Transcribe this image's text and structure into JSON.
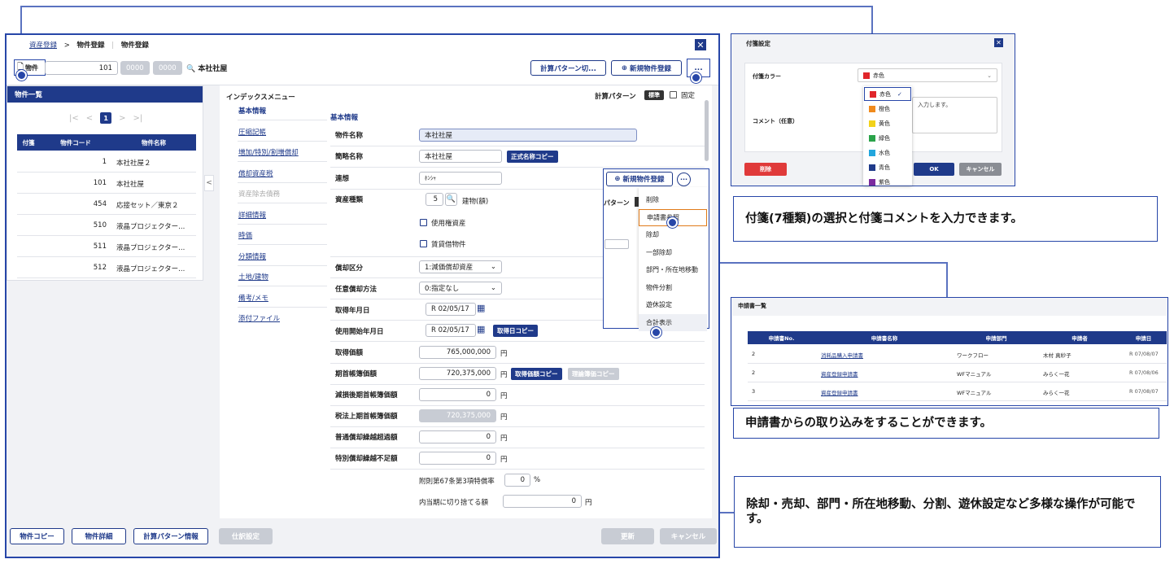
{
  "window": {
    "breadcrumb": {
      "root": "資産登録",
      "sep": ">",
      "parent": "物件登録",
      "current": "物件登録"
    },
    "toolbar": {
      "tag_label": "物件",
      "code_value": "101",
      "sub_code_1": "0000",
      "sub_code_2": "0000",
      "asset_name": "本社社屋",
      "calc_pattern_btn": "計算パターン切...",
      "new_asset_btn": "新規物件登録",
      "more_btn": "..."
    },
    "list_panel": {
      "title": "物件一覧",
      "page": "1",
      "columns": [
        "付箋",
        "物件コード",
        "物件名称"
      ],
      "rows": [
        {
          "code": "1",
          "name": "本社社屋２"
        },
        {
          "code": "101",
          "name": "本社社屋"
        },
        {
          "code": "454",
          "name": "応接セット／東京２"
        },
        {
          "code": "510",
          "name": "液晶プロジェクター..."
        },
        {
          "code": "511",
          "name": "液晶プロジェクター..."
        },
        {
          "code": "512",
          "name": "液晶プロジェクター..."
        }
      ]
    },
    "index_menu": {
      "title": "インデックスメニュー",
      "items": [
        "基本情報",
        "圧縮記帳",
        "増加/特別/割増償却",
        "償却資産税",
        "資産除去債務",
        "詳細情報",
        "時価",
        "分類情報",
        "土地/建物",
        "備考/メモ",
        "添付ファイル"
      ]
    },
    "form": {
      "section_title": "基本情報",
      "calc_pattern_label": "計算パターン",
      "calc_pattern_badge": "標準",
      "fixed_label": "固定",
      "fields": {
        "asset_name_label": "物件名称",
        "asset_name_value": "本社社屋",
        "short_name_label": "簡略名称",
        "short_name_value": "本社社屋",
        "official_copy_btn": "正式名称コピー",
        "assoc_label": "連想",
        "assoc_value": "ﾎﾝｼｬ",
        "asset_type_label": "資産種類",
        "asset_type_code": "5",
        "asset_type_name": "建物(額)",
        "use_right_label": "使用権資産",
        "lease_label": "賃貸借物件",
        "dep_class_label": "償却区分",
        "dep_class_value": "1:減価償却資産",
        "opt_dep_label": "任意償却方法",
        "opt_dep_value": "0:指定なし",
        "acq_date_label": "取得年月日",
        "acq_date_value": "R 02/05/17",
        "use_date_label": "使用開始年月日",
        "use_date_value": "R 02/05/17",
        "acq_copy_btn": "取得日コピー",
        "acq_price_label": "取得価額",
        "acq_price_value": "765,000,000",
        "book_label": "期首帳簿価額",
        "book_value": "720,375,000",
        "price_copy_btn": "取得価額コピー",
        "ideal_copy_btn": "理論簿価コピー",
        "impair_label": "減損後期首帳簿価額",
        "impair_value": "0",
        "tax_label": "税法上期首帳簿価額",
        "tax_value": "720,375,000",
        "excess_label": "普通償却繰越超過額",
        "excess_value": "0",
        "short_label": "特別償却繰越不足額",
        "short_value": "0",
        "rate_label": "附則第67条第3項特償率",
        "rate_value": "0",
        "rate_unit": "%",
        "cut_label": "内当期に切り捨てる額",
        "cut_value": "0",
        "yen": "円"
      }
    },
    "context_menu": {
      "new_btn": "新規物件登録",
      "pattern_fragment": "パターン",
      "items": [
        "削除",
        "申請書参照",
        "除却",
        "一部除却",
        "部門・所在地移動",
        "物件分割",
        "遊休設定",
        "合計表示"
      ]
    },
    "footer": {
      "copy_btn": "物件コピー",
      "detail_btn": "物件詳細",
      "calc_info_btn": "計算パターン情報",
      "journal_btn": "仕訳設定",
      "update_btn": "更新",
      "cancel_btn": "キャンセル"
    }
  },
  "tag_dialog": {
    "title": "付箋設定",
    "color_label": "付箋カラー",
    "color_value": "赤色",
    "comment_label": "コメント（任意）",
    "comment_placeholder": "入力します。",
    "colors": [
      {
        "name": "赤色",
        "hex": "#e0262b"
      },
      {
        "name": "橙色",
        "hex": "#f08a1c"
      },
      {
        "name": "黄色",
        "hex": "#f2d21a"
      },
      {
        "name": "緑色",
        "hex": "#2aa34a"
      },
      {
        "name": "水色",
        "hex": "#22a6dd"
      },
      {
        "name": "青色",
        "hex": "#1f3a8a"
      },
      {
        "name": "紫色",
        "hex": "#7b2a9e"
      }
    ],
    "delete_btn": "削除",
    "ok_btn": "OK",
    "cancel_btn": "キャンセル"
  },
  "app_list": {
    "title": "申請書一覧",
    "columns": [
      "申請書No.",
      "申請書名称",
      "申請部門",
      "申請者",
      "申請日"
    ],
    "rows": [
      {
        "no": "2",
        "name": "消耗品購入申請書",
        "dept": "ワークフロー",
        "person": "木村 真紗子",
        "date": "R 07/08/07"
      },
      {
        "no": "2",
        "name": "資産登録申請書",
        "dept": "WFマニュアル",
        "person": "みらく一花",
        "date": "R 07/08/06"
      },
      {
        "no": "3",
        "name": "資産登録申請書",
        "dept": "WFマニュアル",
        "person": "みらく一花",
        "date": "R 07/08/07"
      }
    ]
  },
  "callouts": {
    "tag": "付箋(7種類)の選択と付箋コメントを入力できます。",
    "apply": "申請書からの取り込みをすることができます。",
    "ops": "除却・売却、部門・所在地移動、分割、遊休設定など多様な操作が可能です。"
  },
  "colors": {
    "primary": "#1f3a8a",
    "frame": "#2746a8",
    "highlight": "#e07b1a",
    "disabled": "#c8ccd4"
  }
}
